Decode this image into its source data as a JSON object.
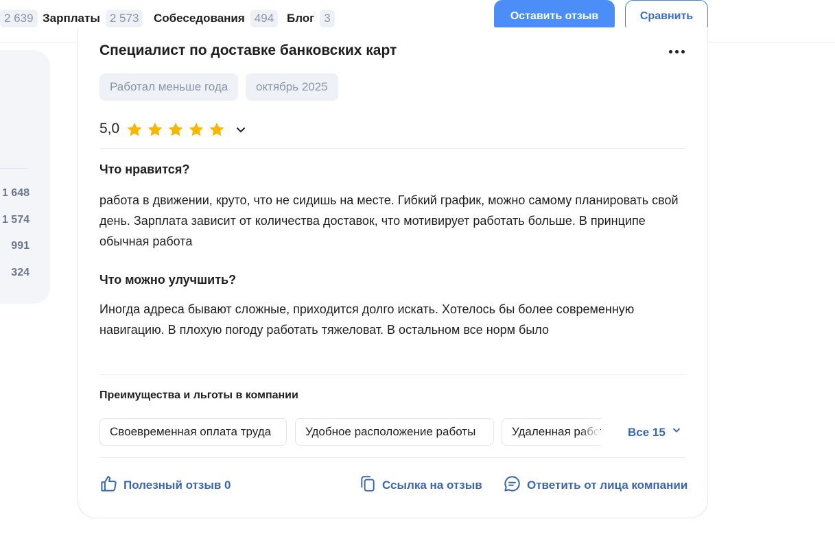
{
  "nav": {
    "items": [
      {
        "label": "",
        "count": "2 639"
      },
      {
        "label": "Зарплаты",
        "count": "2 573"
      },
      {
        "label": "Собеседования",
        "count": "494"
      },
      {
        "label": "Блог",
        "count": "3"
      }
    ],
    "leave_review_label": "Оставить отзыв",
    "compare_label": "Сравнить"
  },
  "side_panel": {
    "counts": [
      "1 648",
      "1 574",
      "991",
      "324"
    ]
  },
  "review": {
    "title": "Специалист по доставке банковских карт",
    "tags": [
      "Работал меньше года",
      "октябрь 2025"
    ],
    "rating": "5,0",
    "stars": 5,
    "likes_heading": "Что нравится?",
    "likes_text": "работа в движении, круто, что не сидишь на месте. Гибкий график, можно самому планировать свой день. Зарплата зависит от количества доставок, что мотивирует работать больше. В принципе обычная работа",
    "improve_heading": "Что можно улучшить?",
    "improve_text": "Иногда адреса бывают сложные, приходится долго искать. Хотелось бы более современную навигацию. В плохую погоду работать тяжеловат. В остальном все норм было",
    "benefits_heading": "Преимущества и льготы в компании",
    "benefits": [
      "Своевременная оплата труда",
      "Удобное расположение работы",
      "Удаленная работа"
    ],
    "benefits_all_label": "Все 15",
    "helpful_label": "Полезный отзыв 0",
    "link_label": "Ссылка на отзыв",
    "reply_label": "Ответить от лица компании"
  },
  "colors": {
    "accent": "#4b8ef7",
    "link": "#3a66b0",
    "star": "#f5b800"
  }
}
